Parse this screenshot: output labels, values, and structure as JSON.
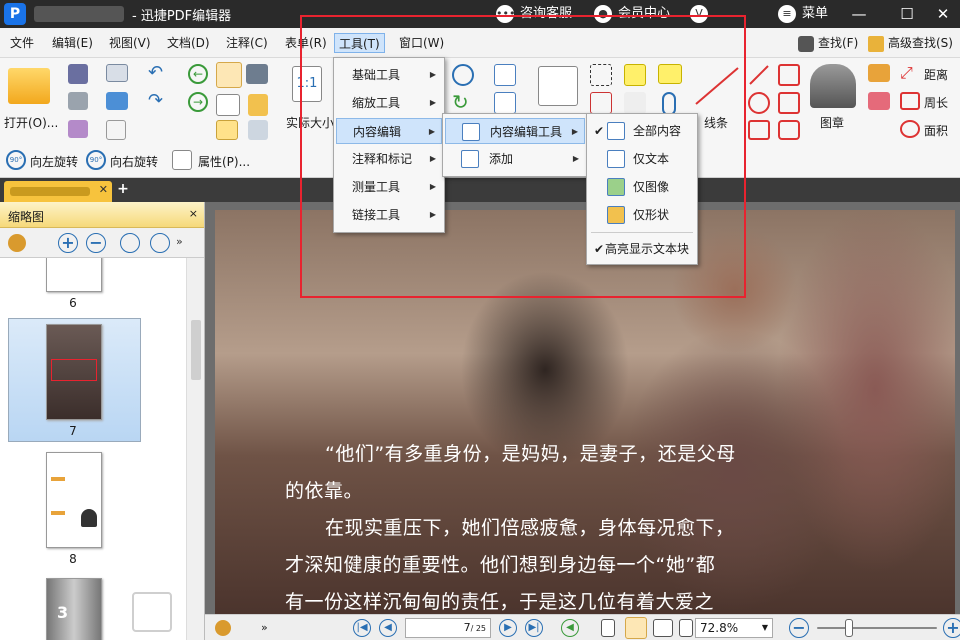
{
  "titlebar": {
    "app_title": "- 迅捷PDF编辑器",
    "support": "咨询客服",
    "member": "会员中心",
    "menu": "菜单",
    "minimize": "—",
    "maximize": "☐",
    "close": "✕"
  },
  "menubar": {
    "items": [
      "文件",
      "编辑(E)",
      "视图(V)",
      "文档(D)",
      "注释(C)",
      "表单(R)",
      "工具(T)",
      "窗口(W)"
    ],
    "find": "查找(F)",
    "advanced_find": "高级查找(S)"
  },
  "ribbon": {
    "open": "打开(O)...",
    "actual_size": "实际大小",
    "lines": "线条",
    "stamp": "图章",
    "distance": "距离",
    "perimeter": "周长",
    "area": "面积",
    "rotate_left": "向左旋转",
    "rotate_right": "向右旋转",
    "properties": "属性(P)...",
    "fit_label": "1:1",
    "rot_badge": "90°"
  },
  "sidebar": {
    "title": "缩略图",
    "close": "×",
    "pages": [
      "6",
      "7",
      "8"
    ],
    "page9_badge": "3"
  },
  "document": {
    "para1_line1": "“他们”有多重身份，是妈妈，是妻子，还是父母",
    "para1_line2": "的依靠。",
    "para2_line1": "在现实重压下，她们倍感疲惫，身体每况愈下，",
    "para2_line2": "才深知健康的重要性。他们想到身边每一个“她”都",
    "para2_line3": "有一份这样沉甸甸的责任，于是这几位有着大爱之"
  },
  "bottombar": {
    "current_page": "7",
    "total_pages": "/ 25",
    "zoom": "72.8%"
  },
  "menus": {
    "tools": [
      "基础工具",
      "缩放工具",
      "内容编辑",
      "注释和标记",
      "测量工具",
      "链接工具"
    ],
    "content_edit": [
      "内容编辑工具",
      "添加"
    ],
    "content_edit_tool": [
      "全部内容",
      "仅文本",
      "仅图像",
      "仅形状"
    ],
    "highlight_blocks": "高亮显示文本块"
  },
  "colors": {
    "highlight_box": "#e8232f",
    "accent_blue": "#2a6fb3",
    "tab_yellow": "#f7c33d"
  }
}
